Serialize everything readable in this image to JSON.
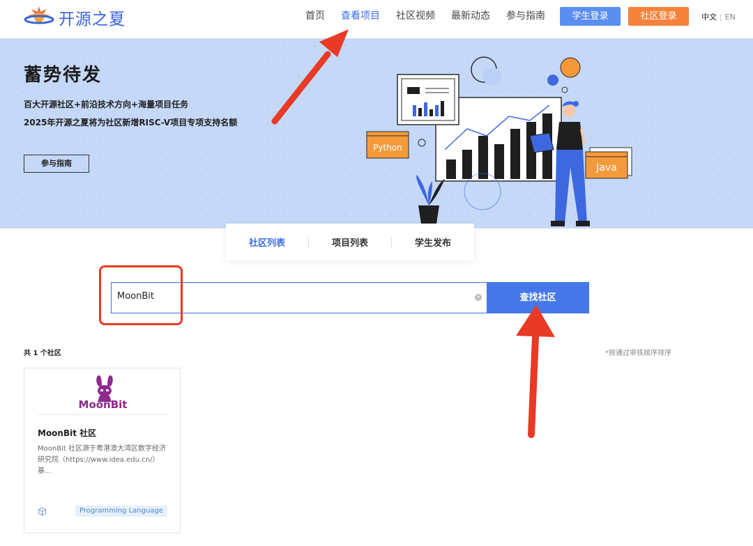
{
  "header": {
    "logo_text": "开源之夏",
    "nav": [
      {
        "label": "首页",
        "active": false
      },
      {
        "label": "查看项目",
        "active": true
      },
      {
        "label": "社区视频",
        "active": false
      },
      {
        "label": "最新动态",
        "active": false
      },
      {
        "label": "参与指南",
        "active": false
      }
    ],
    "student_login": "学生登录",
    "community_login": "社区登录",
    "lang_zh": "中文",
    "lang_sep": "|",
    "lang_en": "EN"
  },
  "banner": {
    "title": "蓄势待发",
    "line1": "百大开源社区+前沿技术方向+海量项目任务",
    "line2": "2025年开源之夏将为社区新增RISC-V项目专项支持名额",
    "button": "参与指南",
    "python_label": "Python",
    "java_label": "Java"
  },
  "tabs": [
    {
      "label": "社区列表",
      "active": true
    },
    {
      "label": "项目列表",
      "active": false
    },
    {
      "label": "学生发布",
      "active": false
    }
  ],
  "search": {
    "value": "MoonBit",
    "button": "查找社区"
  },
  "results": {
    "count_text": "共 1 个社区",
    "sort_note": "*按通过审核顺序排序",
    "cards": [
      {
        "logo_text": "MoonBit",
        "title": "MoonBit 社区",
        "description": "MoonBit 社区源于粤港澳大湾区数字经济研究院（https://www.idea.edu.cn/）基...",
        "tag": "Programming Language"
      }
    ]
  },
  "colors": {
    "accent": "#3b6ce6",
    "orange": "#f5833c",
    "banner_bg": "#c5d8f8",
    "annotation_red": "#e83a25"
  }
}
